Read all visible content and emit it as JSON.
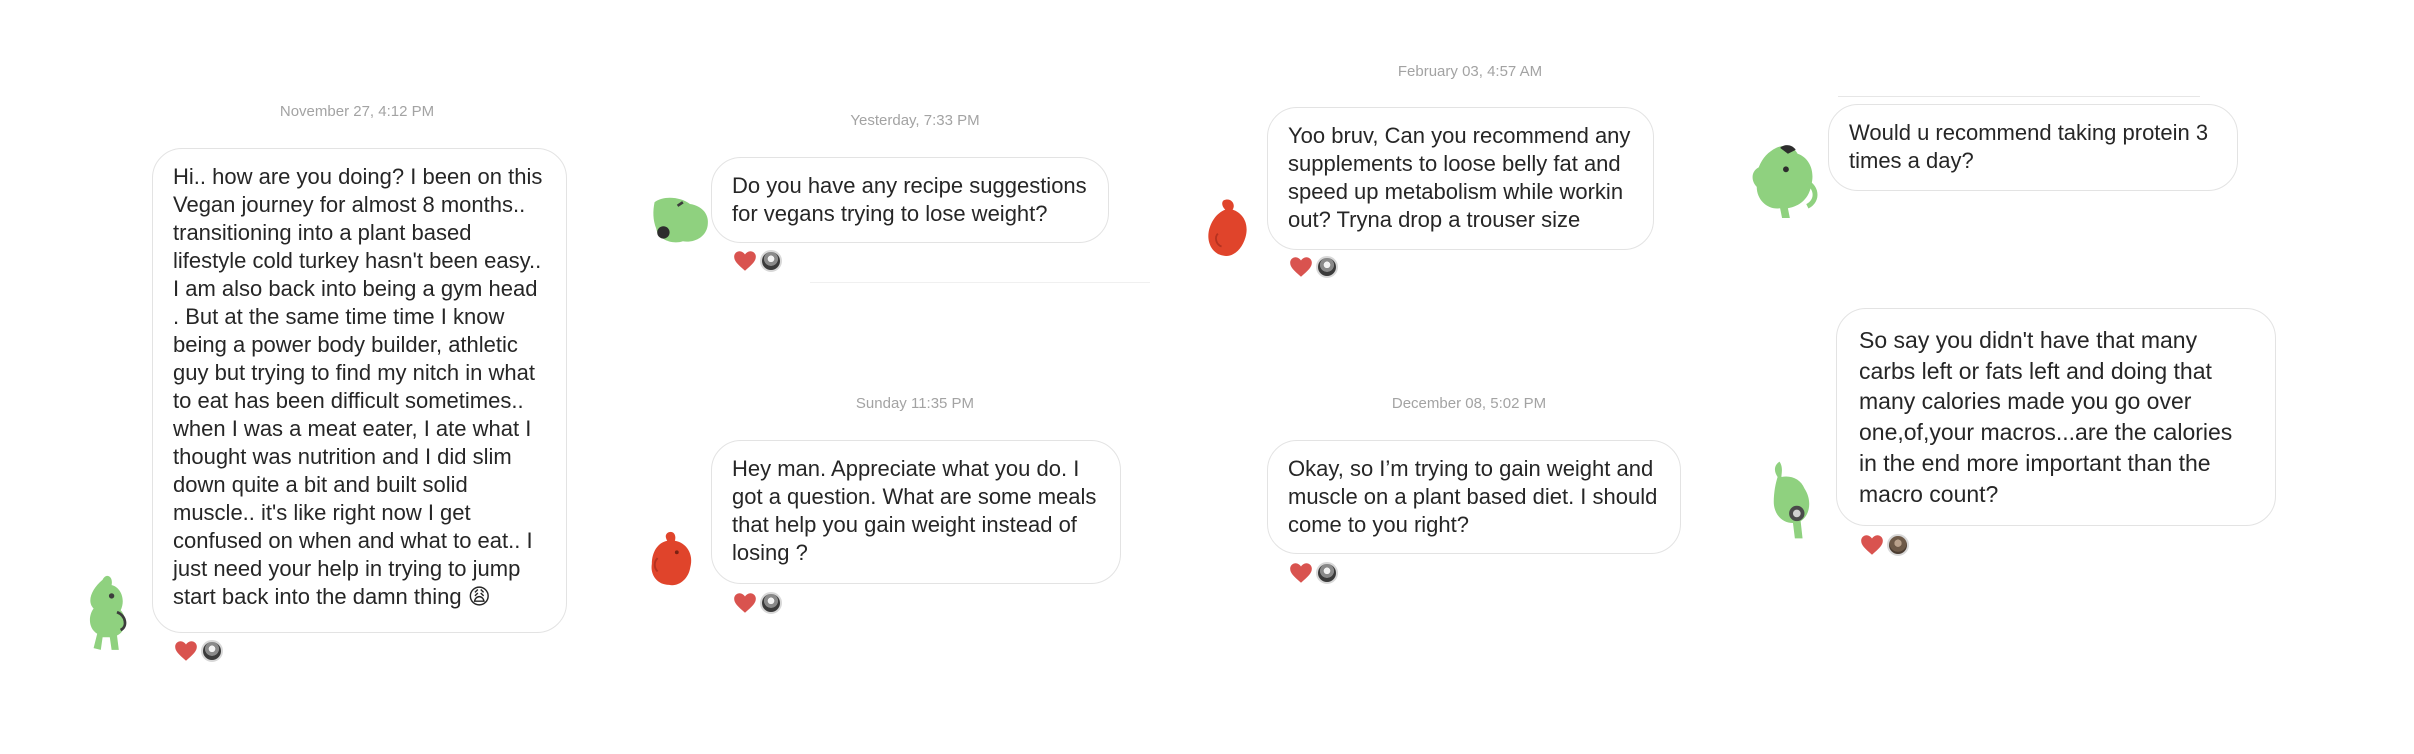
{
  "colors": {
    "green_avatar": "#8fd17f",
    "red_avatar": "#e0442b",
    "heart": "#d9534f",
    "bubble_border": "#e3e3e3",
    "timestamp": "#a3a3a3"
  },
  "threads": [
    {
      "timestamp": "November 27, 4:12 PM",
      "avatar_icon": "green-creature-avatar-icon",
      "message": "Hi.. how are you doing? I been on this Vegan journey for almost 8 months.. transitioning into a plant based lifestyle cold turkey hasn't been easy.. I am also back into being a gym head . But at the same time time I know being a power body builder, athletic guy but trying to find my nitch in what to eat has been difficult sometimes.. when I was a meat eater, I ate what I thought was nutrition and I did slim down quite a bit and built solid muscle.. it's like right now I get confused on when and what to eat.. I just need your help in trying to jump start back into the damn thing 😩"
    },
    {
      "timestamp": "Yesterday, 7:33 PM",
      "avatar_icon": "green-creature-avatar-icon",
      "message": "Do you have any recipe suggestions for vegans trying to lose weight?"
    },
    {
      "timestamp": "Sunday 11:35 PM",
      "avatar_icon": "red-creature-avatar-icon",
      "message": "Hey man. Appreciate what you do. I got a question. What are some meals that help you gain weight instead of losing ?"
    },
    {
      "timestamp": "February 03, 4:57 AM",
      "avatar_icon": "red-creature-avatar-icon",
      "message": "Yoo bruv, Can you recommend any supplements to loose belly fat and speed up metabolism while workin out? Tryna drop a trouser size"
    },
    {
      "timestamp": "December 08, 5:02 PM",
      "avatar_icon": "",
      "message": "Okay, so I’m trying to gain weight and muscle on a plant based diet. I should come to you right?"
    },
    {
      "timestamp": "",
      "avatar_icon": "green-creature-avatar-icon",
      "message": "Would u recommend taking protein 3 times a day?"
    },
    {
      "timestamp": "",
      "avatar_icon": "green-creature-avatar-icon",
      "message": "So say you didn't have that many carbs left or fats left and doing that many calories made you go over one,of,your macros...are the calories in the end more important than the macro count?"
    }
  ],
  "reactions": {
    "heart_icon": "heart-icon",
    "reactor_icon": "reactor-avatar-icon"
  }
}
